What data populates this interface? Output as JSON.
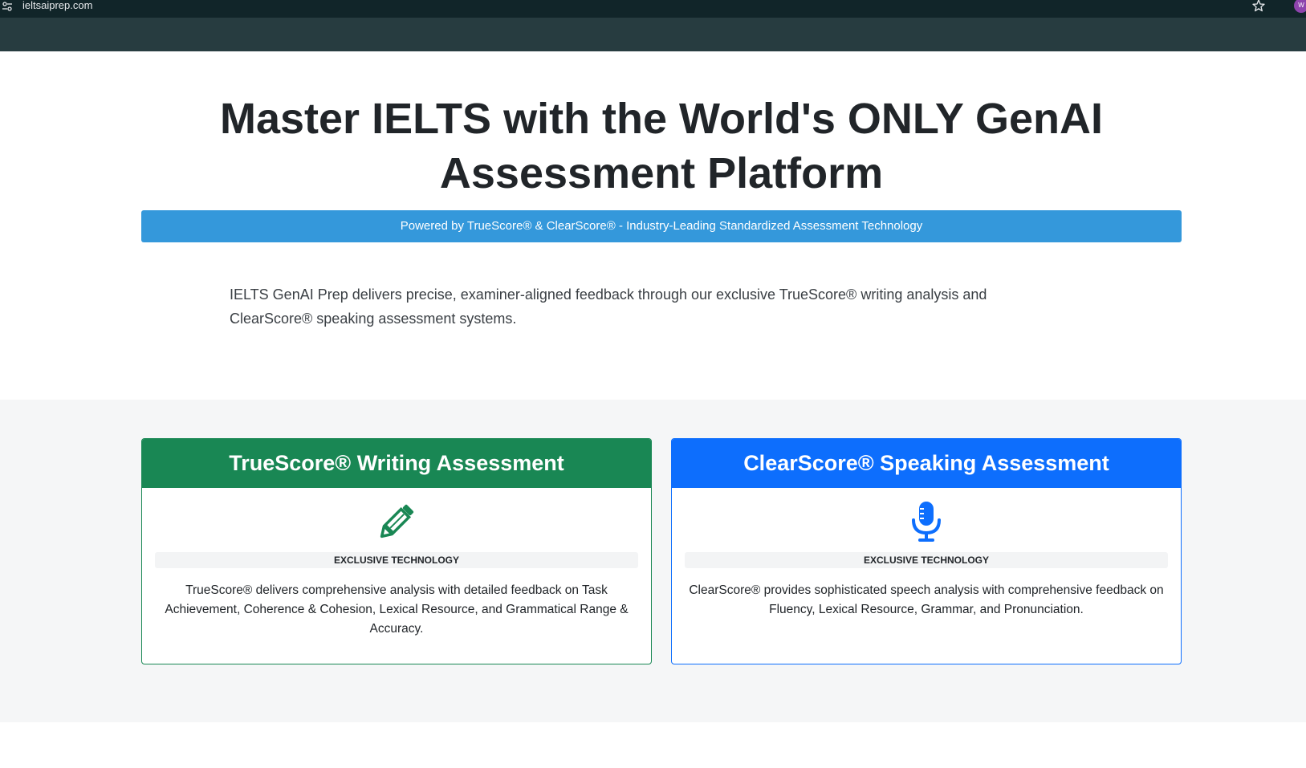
{
  "browser": {
    "url": "ieltsaiprep.com",
    "profile_initial": "W"
  },
  "hero": {
    "title": "Master IELTS with the World's ONLY GenAI Assessment Platform",
    "powered_by": "Powered by TrueScore® & ClearScore® - Industry-Leading Standardized Assessment Technology",
    "intro": "IELTS GenAI Prep delivers precise, examiner-aligned feedback through our exclusive TrueScore® writing analysis and ClearScore® speaking assessment systems."
  },
  "cards": [
    {
      "title": "TrueScore® Writing Assessment",
      "icon": "pencil-icon",
      "badge": "EXCLUSIVE TECHNOLOGY",
      "text": "TrueScore® delivers comprehensive analysis with detailed feedback on Task Achievement, Coherence & Cohesion, Lexical Resource, and Grammatical Range & Accuracy.",
      "color": "#198754"
    },
    {
      "title": "ClearScore® Speaking Assessment",
      "icon": "microphone-icon",
      "badge": "EXCLUSIVE TECHNOLOGY",
      "text": "ClearScore® provides sophisticated speech analysis with comprehensive feedback on Fluency, Lexical Resource, Grammar, and Pronunciation.",
      "color": "#0d6efd"
    }
  ],
  "colors": {
    "accent_blue": "#3498db",
    "green": "#198754",
    "blue": "#0d6efd",
    "nav_dark": "#273c40"
  }
}
